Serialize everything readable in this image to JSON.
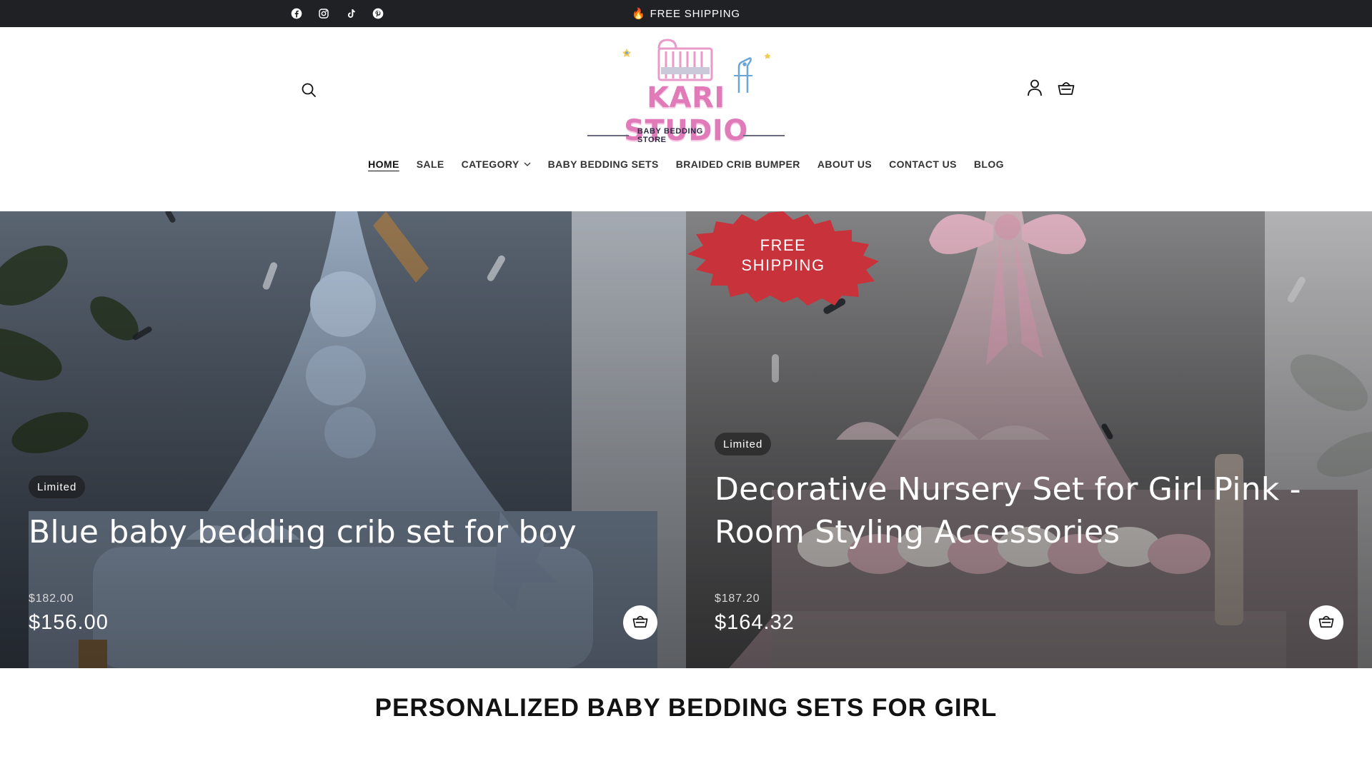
{
  "announcement": {
    "emoji": "🔥",
    "text": "FREE SHIPPING"
  },
  "social": [
    {
      "icon": "facebook-icon"
    },
    {
      "icon": "instagram-icon"
    },
    {
      "icon": "tiktok-icon"
    },
    {
      "icon": "pinterest-icon"
    }
  ],
  "logo": {
    "name": "KARI STUDIO",
    "tagline": "BABY BEDDING STORE"
  },
  "nav": {
    "items": [
      {
        "label": "HOME",
        "active": true
      },
      {
        "label": "SALE"
      },
      {
        "label": "CATEGORY",
        "has_dropdown": true
      },
      {
        "label": "BABY BEDDING SETS"
      },
      {
        "label": "BRAIDED CRIB BUMPER"
      },
      {
        "label": "ABOUT US"
      },
      {
        "label": "CONTACT US"
      },
      {
        "label": "BLOG"
      }
    ]
  },
  "header_icons": [
    "search-icon",
    "account-icon",
    "cart-icon"
  ],
  "heroes": [
    {
      "badge": "Limited",
      "title": "Blue baby bedding crib set for boy",
      "compare_price": "$182.00",
      "price": "$156.00"
    },
    {
      "ribbon_line1": "FREE",
      "ribbon_line2": "SHIPPING",
      "badge": "Limited",
      "title_line1": "Decorative Nursery Set for Girl Pink -",
      "title_line2": "Room Styling Accessories",
      "compare_price": "$187.20",
      "price": "$164.32"
    }
  ],
  "section": {
    "title": "PERSONALIZED BABY BEDDING SETS FOR GIRL"
  },
  "colors": {
    "topbar": "#202124",
    "brand_pink": "#e07ab8",
    "ribbon_red": "#c8323a",
    "text_dark": "#121212"
  }
}
